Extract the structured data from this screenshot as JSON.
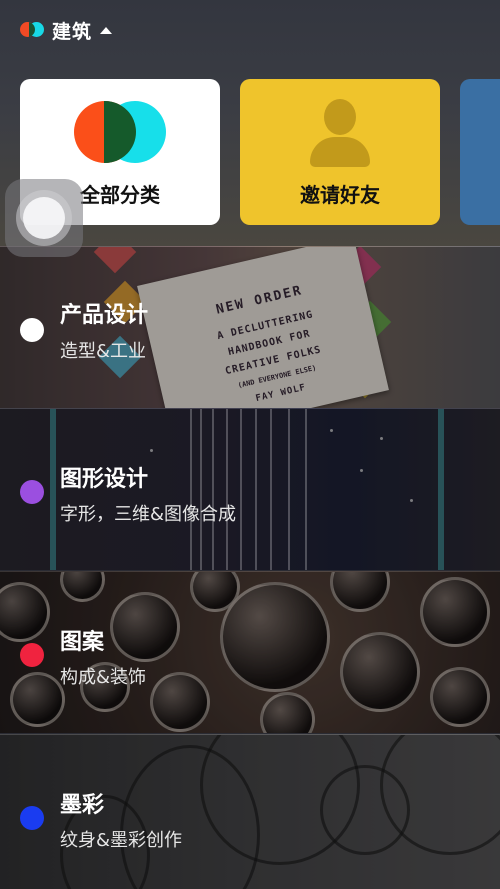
{
  "header": {
    "title": "建筑",
    "logo_colors": [
      "#f04a25",
      "#18d8e6",
      "#1a5130"
    ]
  },
  "cards": [
    {
      "label": "全部分类",
      "icon": "venn-icon",
      "bg": "#ffffff"
    },
    {
      "label": "邀请好友",
      "icon": "person-icon",
      "bg": "#efc42c"
    }
  ],
  "book_cover": {
    "lines": [
      "NEW ORDER",
      "A DECLUTTERING",
      "HANDBOOK FOR",
      "CREATIVE FOLKS",
      "(AND EVERYONE ELSE)",
      "FAY WOLF"
    ]
  },
  "categories": [
    {
      "title": "产品设计",
      "subtitle": "造型&工业",
      "dot_color": "#ffffff"
    },
    {
      "title": "图形设计",
      "subtitle": "字形，三维&图像合成",
      "dot_color": "#9b4fe0"
    },
    {
      "title": "图案",
      "subtitle": "构成&装饰",
      "dot_color": "#f0233f"
    },
    {
      "title": "墨彩",
      "subtitle": "纹身&墨彩创作",
      "dot_color": "#1a3cf0"
    }
  ]
}
